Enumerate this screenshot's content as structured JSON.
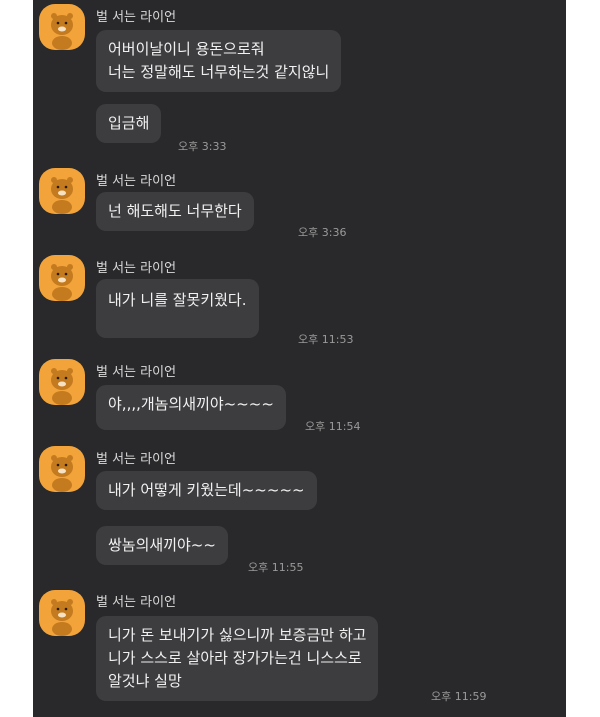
{
  "chat": {
    "sender_name": "벌 서는 라이언",
    "groups": [
      {
        "messages": [
          {
            "lines": [
              "어버이날이니 용돈으로줘",
              "너는 정말해도 너무하는것 같지않니"
            ]
          },
          {
            "lines": [
              "입금해"
            ],
            "time": "오후 3:33"
          }
        ]
      },
      {
        "messages": [
          {
            "lines": [
              "넌 해도해도 너무한다"
            ],
            "time": "오후 3:36"
          }
        ]
      },
      {
        "messages": [
          {
            "lines": [
              "내가 니를 잘못키웠다."
            ],
            "time": "오후 11:53"
          }
        ]
      },
      {
        "messages": [
          {
            "lines": [
              "야,,,,개놈의새끼야~~~~"
            ],
            "time": "오후 11:54"
          }
        ]
      },
      {
        "messages": [
          {
            "lines": [
              "내가 어떻게 키웠는데~~~~~"
            ]
          },
          {
            "lines": [
              "쌍놈의새끼야~~"
            ],
            "time": "오후 11:55"
          }
        ]
      },
      {
        "messages": [
          {
            "lines": [
              "니가 돈 보내기가 싫으니까 보증금만 하고",
              "니가 스스로 살아라 장가가는건 니스스로",
              "알것냐 실망"
            ],
            "time": "오후 11:59"
          }
        ]
      }
    ]
  },
  "colors": {
    "background": "#29292b",
    "bubble": "#3d3d40",
    "avatar": "#f2a33a",
    "text": "#f1f1f1",
    "timestamp": "#9a9a9a"
  },
  "icons": {
    "avatar": "ryan-character-icon"
  }
}
